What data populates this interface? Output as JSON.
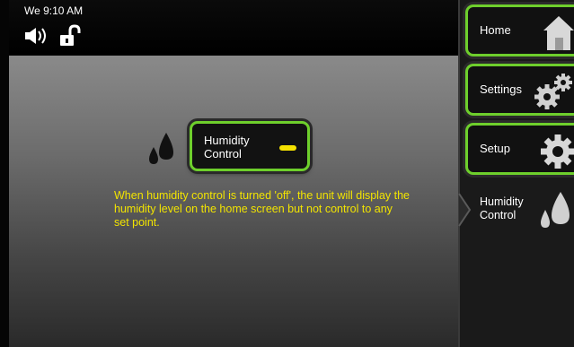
{
  "status_bar": {
    "time": "We 9:10 AM",
    "speaker_icon": "speaker-icon",
    "lock_icon": "unlocked-padlock-icon"
  },
  "main": {
    "humidity_button": {
      "label": "Humidity Control",
      "indicator_color": "#f4e100"
    },
    "help_text": "When humidity control is turned 'off', the unit will display the humidity level on the home screen but not control to any set point."
  },
  "sidebar": {
    "items": [
      {
        "label": "Home",
        "icon": "house-icon"
      },
      {
        "label": "Settings",
        "icon": "gears-icon"
      },
      {
        "label": "Setup",
        "icon": "gear-icon"
      }
    ],
    "active": {
      "label": "Humidity Control",
      "icon": "water-drops-icon"
    }
  },
  "colors": {
    "accent_green": "#6ecf2c",
    "text_yellow": "#f2e400"
  }
}
